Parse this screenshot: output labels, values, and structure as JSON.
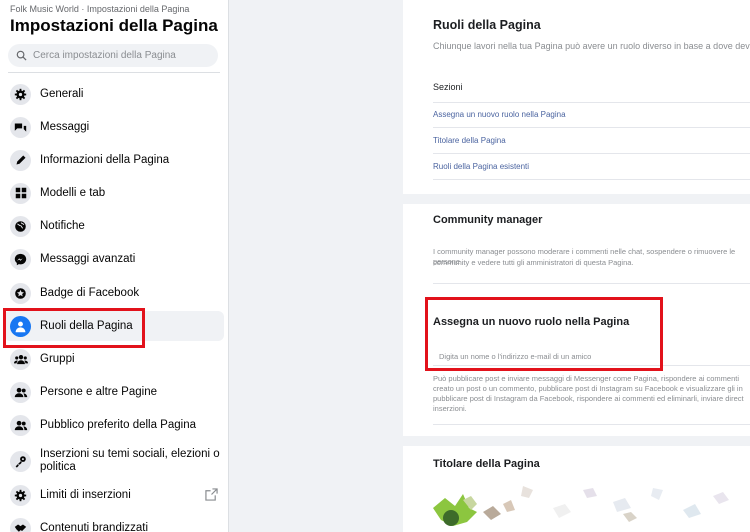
{
  "sidebar": {
    "breadcrumb": "Folk Music World · Impostazioni della Pagina",
    "title": "Impostazioni della Pagina",
    "search_placeholder": "Cerca impostazioni della Pagina",
    "items": [
      {
        "label": "Generali",
        "icon": "gear-icon"
      },
      {
        "label": "Messaggi",
        "icon": "chat-bubbles-icon"
      },
      {
        "label": "Informazioni della Pagina",
        "icon": "pencil-icon"
      },
      {
        "label": "Modelli e tab",
        "icon": "grid-icon"
      },
      {
        "label": "Notifiche",
        "icon": "globe-icon"
      },
      {
        "label": "Messaggi avanzati",
        "icon": "messenger-icon"
      },
      {
        "label": "Badge di Facebook",
        "icon": "star-badge-icon"
      },
      {
        "label": "Ruoli della Pagina",
        "icon": "person-icon",
        "active": true
      },
      {
        "label": "Gruppi",
        "icon": "group-icon"
      },
      {
        "label": "Persone e altre Pagine",
        "icon": "people-icon"
      },
      {
        "label": "Pubblico preferito della Pagina",
        "icon": "people-icon"
      },
      {
        "label": "Inserzioni su temi sociali, elezioni o politica",
        "icon": "key-icon"
      },
      {
        "label": "Limiti di inserzioni",
        "icon": "gear-icon"
      },
      {
        "label": "Contenuti brandizzati",
        "icon": "handshake-icon"
      }
    ]
  },
  "main": {
    "roles_title": "Ruoli della Pagina",
    "roles_subtitle": "Chiunque lavori nella tua Pagina può avere un ruolo diverso in base a dove devec",
    "sections_label": "Sezioni",
    "section_links": [
      "Assegna un nuovo ruolo nella Pagina",
      "Titolare della Pagina",
      "Ruoli della Pagina esistenti"
    ],
    "community_title": "Community manager",
    "community_desc_1": "I community manager possono moderare i commenti nelle chat, sospendere o rimuovere le persone",
    "community_desc_2": "community e vedere tutti gli amministratori di questa Pagina.",
    "assign_title": "Assegna un nuovo ruolo nella Pagina",
    "assign_placeholder": "Digita un nome o l'indirizzo e-mail di un amico",
    "assign_desc_1": "Può pubblicare post e inviare messaggi di Messenger come Pagina, rispondere ai commenti",
    "assign_desc_2": "creato un post o un commento, pubblicare post di Instagram su Facebook e visualizzare gli in",
    "assign_desc_3": "pubblicare post di Instagram da Facebook, rispondere ai commenti ed eliminarli, inviare direct",
    "assign_desc_4": "inserzioni.",
    "owner_title": "Titolare della Pagina"
  },
  "colors": {
    "accent": "#1877f2",
    "highlight": "#e2121b",
    "link": "#4b64a0"
  }
}
